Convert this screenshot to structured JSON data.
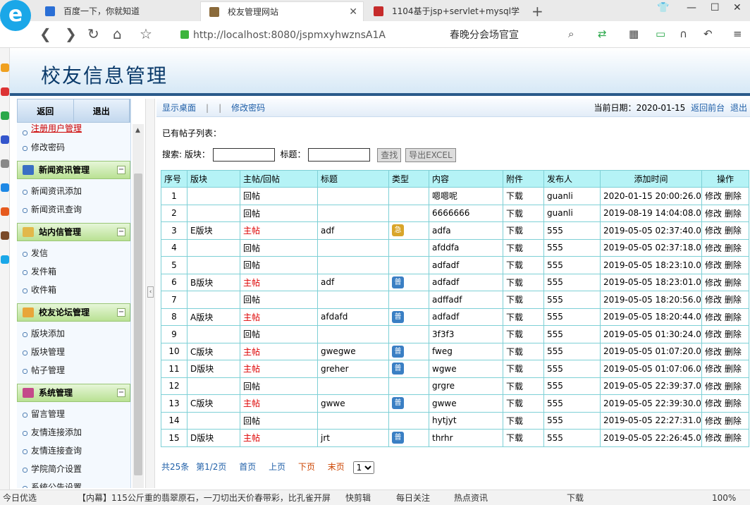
{
  "browser": {
    "logo_glyph": "e",
    "tabs": [
      {
        "title": "百度一下，你就知道"
      },
      {
        "title": "校友管理网站"
      },
      {
        "title": "1104基于jsp+servlet+mysql学"
      }
    ],
    "new_tab_glyph": "+",
    "url": "http://localhost:8080/jspmxyhwznsA1A",
    "ext_text": "春晚分会场官宣"
  },
  "app": {
    "title": "校友信息管理",
    "side_buttons": {
      "back": "返回",
      "exit": "退出"
    },
    "sidebar": {
      "top_items": [
        "注册用户管理",
        "修改密码"
      ],
      "groups": [
        {
          "title": "新闻资讯管理",
          "items": [
            "新闻资讯添加",
            "新闻资讯查询"
          ]
        },
        {
          "title": "站内信管理",
          "items": [
            "发信",
            "发件箱",
            "收件箱"
          ]
        },
        {
          "title": "校友论坛管理",
          "items": [
            "版块添加",
            "版块管理",
            "帖子管理"
          ]
        },
        {
          "title": "系统管理",
          "items": [
            "留言管理",
            "友情连接添加",
            "友情连接查询",
            "学院简介设置",
            "系统公告设置"
          ]
        }
      ]
    },
    "topnav": {
      "desktop": "显示桌面",
      "change_pwd": "修改密码",
      "date_label": "当前日期：",
      "date": "2020-01-15",
      "back_front": "返回前台",
      "logout": "退出"
    },
    "list_caption": "已有帖子列表：",
    "search": {
      "label": "搜索:",
      "board_label": "版块：",
      "title_label": "标题：",
      "find_btn": "查找",
      "export_btn": "导出EXCEL"
    },
    "table": {
      "headers": [
        "序号",
        "版块",
        "主帖/回帖",
        "标题",
        "类型",
        "内容",
        "附件",
        "发布人",
        "添加时间",
        "操作"
      ],
      "action_edit": "修改",
      "action_delete": "删除",
      "rows": [
        {
          "no": "1",
          "board": "",
          "kind": "回帖",
          "title": "",
          "type": "",
          "content": "嗯嗯呢",
          "attach": "下载",
          "author": "guanli",
          "time": "2020-01-15 20:00:26.0"
        },
        {
          "no": "2",
          "board": "",
          "kind": "回帖",
          "title": "",
          "type": "",
          "content": "6666666",
          "attach": "下载",
          "author": "guanli",
          "time": "2019-08-19 14:04:08.0"
        },
        {
          "no": "3",
          "board": "E版块",
          "kind": "主帖",
          "title": "adf",
          "type": "急",
          "content": "adfa",
          "attach": "下载",
          "author": "555",
          "time": "2019-05-05 02:37:40.0"
        },
        {
          "no": "4",
          "board": "",
          "kind": "回帖",
          "title": "",
          "type": "",
          "content": "afddfa",
          "attach": "下载",
          "author": "555",
          "time": "2019-05-05 02:37:18.0"
        },
        {
          "no": "5",
          "board": "",
          "kind": "回帖",
          "title": "",
          "type": "",
          "content": "adfadf",
          "attach": "下载",
          "author": "555",
          "time": "2019-05-05 18:23:10.0"
        },
        {
          "no": "6",
          "board": "B版块",
          "kind": "主帖",
          "title": "adf",
          "type": "普",
          "content": "adfadf",
          "attach": "下载",
          "author": "555",
          "time": "2019-05-05 18:23:01.0"
        },
        {
          "no": "7",
          "board": "",
          "kind": "回帖",
          "title": "",
          "type": "",
          "content": "adffadf",
          "attach": "下载",
          "author": "555",
          "time": "2019-05-05 18:20:56.0"
        },
        {
          "no": "8",
          "board": "A版块",
          "kind": "主帖",
          "title": "afdafd",
          "type": "普",
          "content": "adfadf",
          "attach": "下载",
          "author": "555",
          "time": "2019-05-05 18:20:44.0"
        },
        {
          "no": "9",
          "board": "",
          "kind": "回帖",
          "title": "",
          "type": "",
          "content": "3f3f3",
          "attach": "下载",
          "author": "555",
          "time": "2019-05-05 01:30:24.0"
        },
        {
          "no": "10",
          "board": "C版块",
          "kind": "主帖",
          "title": "gwegwe",
          "type": "普",
          "content": "fweg",
          "attach": "下载",
          "author": "555",
          "time": "2019-05-05 01:07:20.0"
        },
        {
          "no": "11",
          "board": "D版块",
          "kind": "主帖",
          "title": "greher",
          "type": "普",
          "content": "wgwe",
          "attach": "下载",
          "author": "555",
          "time": "2019-05-05 01:07:06.0"
        },
        {
          "no": "12",
          "board": "",
          "kind": "回帖",
          "title": "",
          "type": "",
          "content": "grgre",
          "attach": "下载",
          "author": "555",
          "time": "2019-05-05 22:39:37.0"
        },
        {
          "no": "13",
          "board": "C版块",
          "kind": "主帖",
          "title": "gwwe",
          "type": "普",
          "content": "gwwe",
          "attach": "下载",
          "author": "555",
          "time": "2019-05-05 22:39:30.0"
        },
        {
          "no": "14",
          "board": "",
          "kind": "回帖",
          "title": "",
          "type": "",
          "content": "hytjyt",
          "attach": "下载",
          "author": "555",
          "time": "2019-05-05 22:27:31.0"
        },
        {
          "no": "15",
          "board": "D版块",
          "kind": "主帖",
          "title": "jrt",
          "type": "普",
          "content": "thrhr",
          "attach": "下载",
          "author": "555",
          "time": "2019-05-05 22:26:45.0"
        }
      ]
    },
    "pager": {
      "total": "共25条",
      "page": "第1/2页",
      "first": "首页",
      "prev": "上页",
      "next": "下页",
      "last": "末页",
      "current": "1"
    }
  },
  "statusbar": {
    "left": "今日优选",
    "news": "【内幕】115公斤重的翡翠原石，一刀切出天价春带彩，比孔雀开屏",
    "clip": "快剪辑",
    "daily": "每日关注",
    "hot": "热点资讯",
    "download": "下载",
    "zoom": "100%"
  },
  "colors": {
    "accent_blue": "#1f5fa8",
    "table_header": "#b5f3f6",
    "table_border": "#7ed0d6",
    "main_post_red": "#d00000",
    "sidebar_group_green": "#b9e193"
  }
}
